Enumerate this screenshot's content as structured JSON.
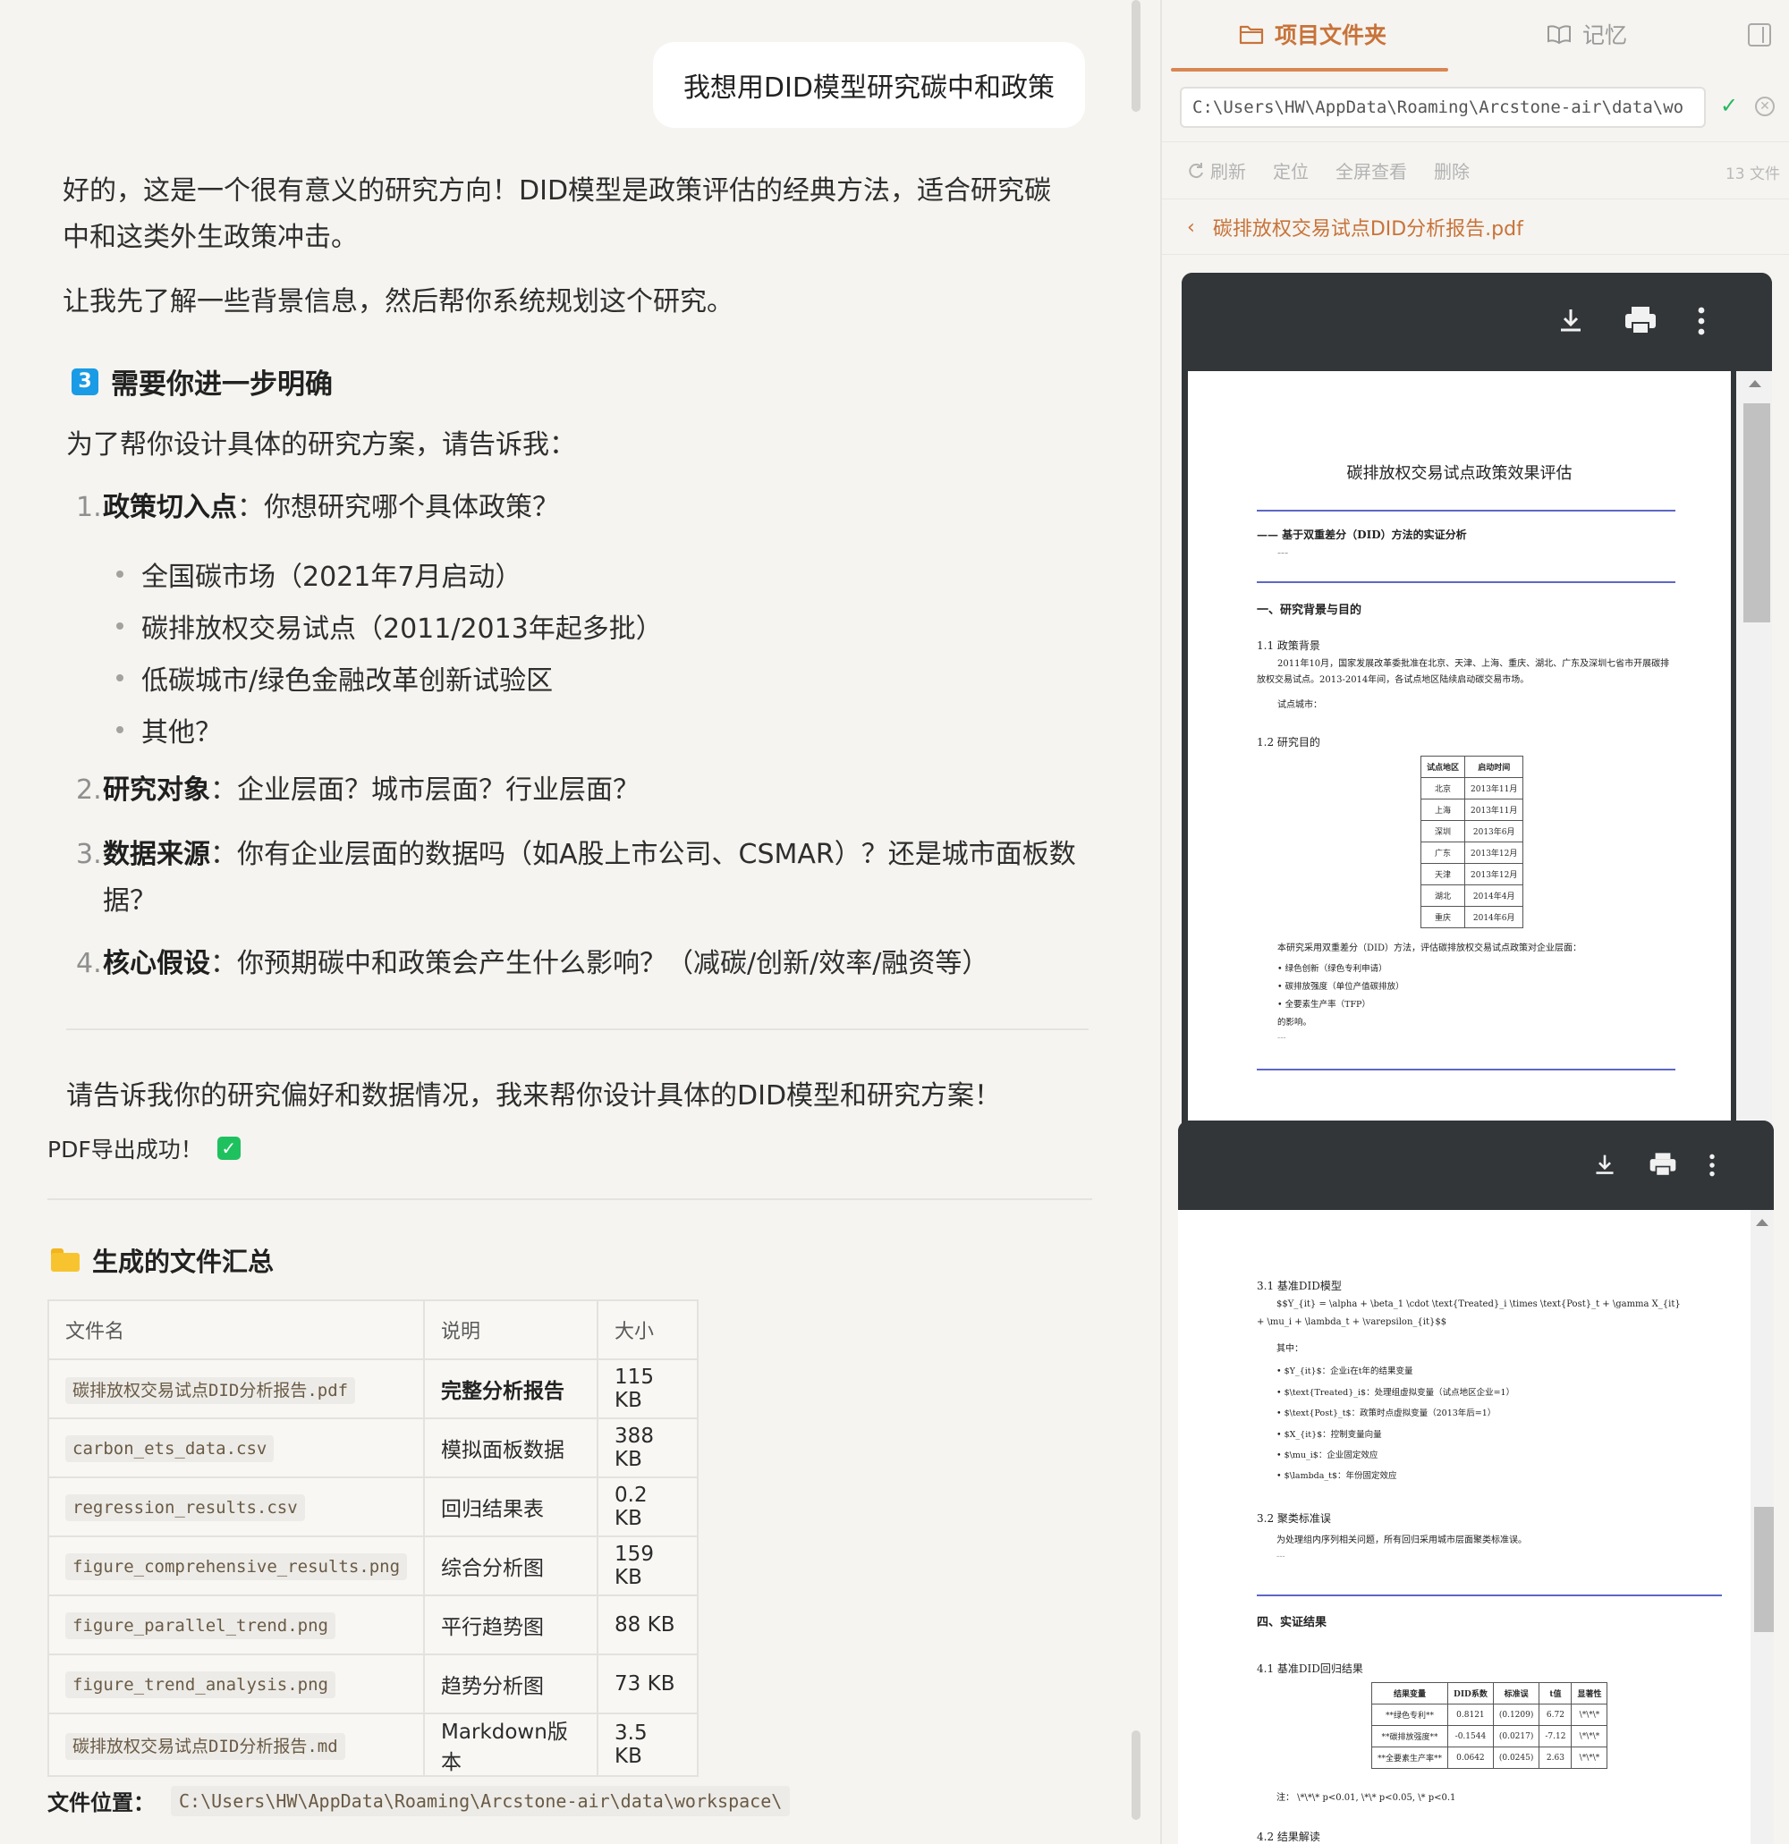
{
  "user_message": "我想用DID模型研究碳中和政策",
  "assistant": {
    "para1": "好的，这是一个很有意义的研究方向！DID模型是政策评估的经典方法，适合研究碳中和这类外生政策冲击。",
    "para2": "让我先了解一些背景信息，然后帮你系统规划这个研究。",
    "section_badge": "3",
    "section_title": "需要你进一步明确",
    "intro": "为了帮你设计具体的研究方案，请告诉我：",
    "items": [
      {
        "num": "1.",
        "label": "政策切入点",
        "text": "：你想研究哪个具体政策？"
      },
      {
        "num": "2.",
        "label": "研究对象",
        "text": "：企业层面？城市层面？行业层面？"
      },
      {
        "num": "3.",
        "label": "数据来源",
        "text": "：你有企业层面的数据吗（如A股上市公司、CSMAR）？还是城市面板数据？"
      },
      {
        "num": "4.",
        "label": "核心假设",
        "text": "：你预期碳中和政策会产生什么影响？（减碳/创新/效率/融资等）"
      }
    ],
    "bullets": [
      "全国碳市场（2021年7月启动）",
      "碳排放权交易试点（2011/2013年起多批）",
      "低碳城市/绿色金融改革创新试验区",
      "其他？"
    ],
    "closing": "请告诉我你的研究偏好和数据情况，我来帮你设计具体的DID模型和研究方案！",
    "pdf_ok": "PDF导出成功！",
    "files_title": "生成的文件汇总",
    "table_headers": [
      "文件名",
      "说明",
      "大小"
    ],
    "files": [
      {
        "name": "碳排放权交易试点DID分析报告.pdf",
        "desc": "完整分析报告",
        "size": "115 KB"
      },
      {
        "name": "carbon_ets_data.csv",
        "desc": "模拟面板数据",
        "size": "388 KB"
      },
      {
        "name": "regression_results.csv",
        "desc": "回归结果表",
        "size": "0.2 KB"
      },
      {
        "name": "figure_comprehensive_results.png",
        "desc": "综合分析图",
        "size": "159 KB"
      },
      {
        "name": "figure_parallel_trend.png",
        "desc": "平行趋势图",
        "size": "88 KB"
      },
      {
        "name": "figure_trend_analysis.png",
        "desc": "趋势分析图",
        "size": "73 KB"
      },
      {
        "name": "碳排放权交易试点DID分析报告.md",
        "desc": "Markdown版本",
        "size": "3.5 KB"
      }
    ],
    "file_location_label": "文件位置：",
    "file_location": "C:\\Users\\HW\\AppData\\Roaming\\Arcstone-air\\data\\workspace\\"
  },
  "right_panel": {
    "tab_project": "项目文件夹",
    "tab_memory": "记忆",
    "path": "C:\\Users\\HW\\AppData\\Roaming\\Arcstone-air\\data\\wo",
    "actions": [
      "刷新",
      "定位",
      "全屏查看",
      "删除"
    ],
    "file_count": "13 文件",
    "current_file": "碳排放权交易试点DID分析报告.pdf",
    "icons": [
      "folder-icon",
      "book-icon",
      "panel-toggle-icon",
      "check-icon",
      "close-icon",
      "refresh-icon",
      "chevron-left-icon",
      "download-icon",
      "print-icon",
      "more-icon"
    ]
  },
  "pdf_page1": {
    "title": "碳排放权交易试点政策效果评估",
    "subtitle": "—— 基于双重差分（DID）方法的实证分析",
    "dash1": "---",
    "sec1": "一、研究背景与目的",
    "sec11": "1.1 政策背景",
    "sec11_text1": "2011年10月，国家发展改革委批准在北京、天津、上海、重庆、湖北、广东及深圳七省市开展碳排",
    "sec11_text2": "放权交易试点。2013-2014年间，各试点地区陆续启动碳交易市场。",
    "pilot_label": "试点城市：",
    "sec12": "1.2 研究目的",
    "table_head": [
      "试点地区",
      "启动时间"
    ],
    "table_rows": [
      [
        "北京",
        "2013年11月"
      ],
      [
        "上海",
        "2013年11月"
      ],
      [
        "深圳",
        "2013年6月"
      ],
      [
        "广东",
        "2013年12月"
      ],
      [
        "天津",
        "2013年12月"
      ],
      [
        "湖北",
        "2014年4月"
      ],
      [
        "重庆",
        "2014年6月"
      ]
    ],
    "method_text": "本研究采用双重差分（DID）方法，评估碳排放权交易试点政策对企业层面：",
    "bullets": [
      "• 绿色创新（绿色专利申请）",
      "• 碳排放强度（单位产值碳排放）",
      "• 全要素生产率（TFP）"
    ],
    "impact": "的影响。",
    "dash2": "---"
  },
  "pdf_page2": {
    "sec31": "3.1 基准DID模型",
    "formula1": "$$Y_{it} = \\alpha + \\beta_1 \\cdot \\text{Treated}_i \\times \\text{Post}_t + \\gamma X_{it}",
    "formula2": "+ \\mu_i + \\lambda_t + \\varepsilon_{it}$$",
    "where": "其中：",
    "vars": [
      "• $Y_{it}$：企业i在t年的结果变量",
      "• $\\text{Treated}_i$：处理组虚拟变量（试点地区企业=1）",
      "• $\\text{Post}_t$：政策时点虚拟变量（2013年后=1）",
      "• $X_{it}$：控制变量向量",
      "• $\\mu_i$：企业固定效应",
      "• $\\lambda_t$：年份固定效应"
    ],
    "sec32": "3.2 聚类标准误",
    "sec32_text": "为处理组内序列相关问题，所有回归采用城市层面聚类标准误。",
    "dash": "---",
    "sec4": "四、实证结果",
    "sec41": "4.1 基准DID回归结果",
    "res_head": [
      "结果变量",
      "DID系数",
      "标准误",
      "t值",
      "显著性"
    ],
    "res_rows": [
      [
        "**绿色专利**",
        "0.8121",
        "(0.1209)",
        "6.72",
        "\\*\\*\\*"
      ],
      [
        "**碳排放强度**",
        "-0.1544",
        "(0.0217)",
        "-7.12",
        "\\*\\*\\*"
      ],
      [
        "**全要素生产率**",
        "0.0642",
        "(0.0245)",
        "2.63",
        "\\*\\*\\*"
      ]
    ],
    "note": "注： \\*\\*\\* p<0.01, \\*\\* p<0.05, \\* p<0.1",
    "sec42": "4.2 结果解读"
  }
}
